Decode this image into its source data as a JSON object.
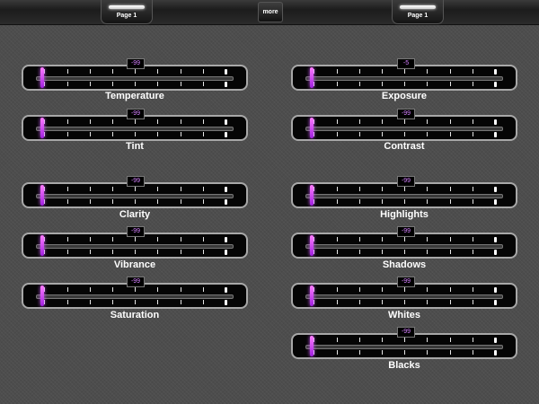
{
  "topbar": {
    "left_tab_label": "Page 1",
    "right_tab_label": "Page 1",
    "more_label": "more"
  },
  "sliders": {
    "temperature": {
      "label": "Temperature",
      "value": "-99"
    },
    "tint": {
      "label": "Tint",
      "value": "-99"
    },
    "clarity": {
      "label": "Clarity",
      "value": "-99"
    },
    "vibrance": {
      "label": "Vibrance",
      "value": "-99"
    },
    "saturation": {
      "label": "Saturation",
      "value": "-99"
    },
    "exposure": {
      "label": "Exposure",
      "value": "-5"
    },
    "contrast": {
      "label": "Contrast",
      "value": "-99"
    },
    "highlights": {
      "label": "Highlights",
      "value": "-99"
    },
    "shadows": {
      "label": "Shadows",
      "value": "-99"
    },
    "whites": {
      "label": "Whites",
      "value": "-99"
    },
    "blacks": {
      "label": "Blacks",
      "value": "-99"
    }
  },
  "colors": {
    "accent": "#c040ff",
    "background": "#4d4d4d",
    "text": "#ffffff"
  }
}
